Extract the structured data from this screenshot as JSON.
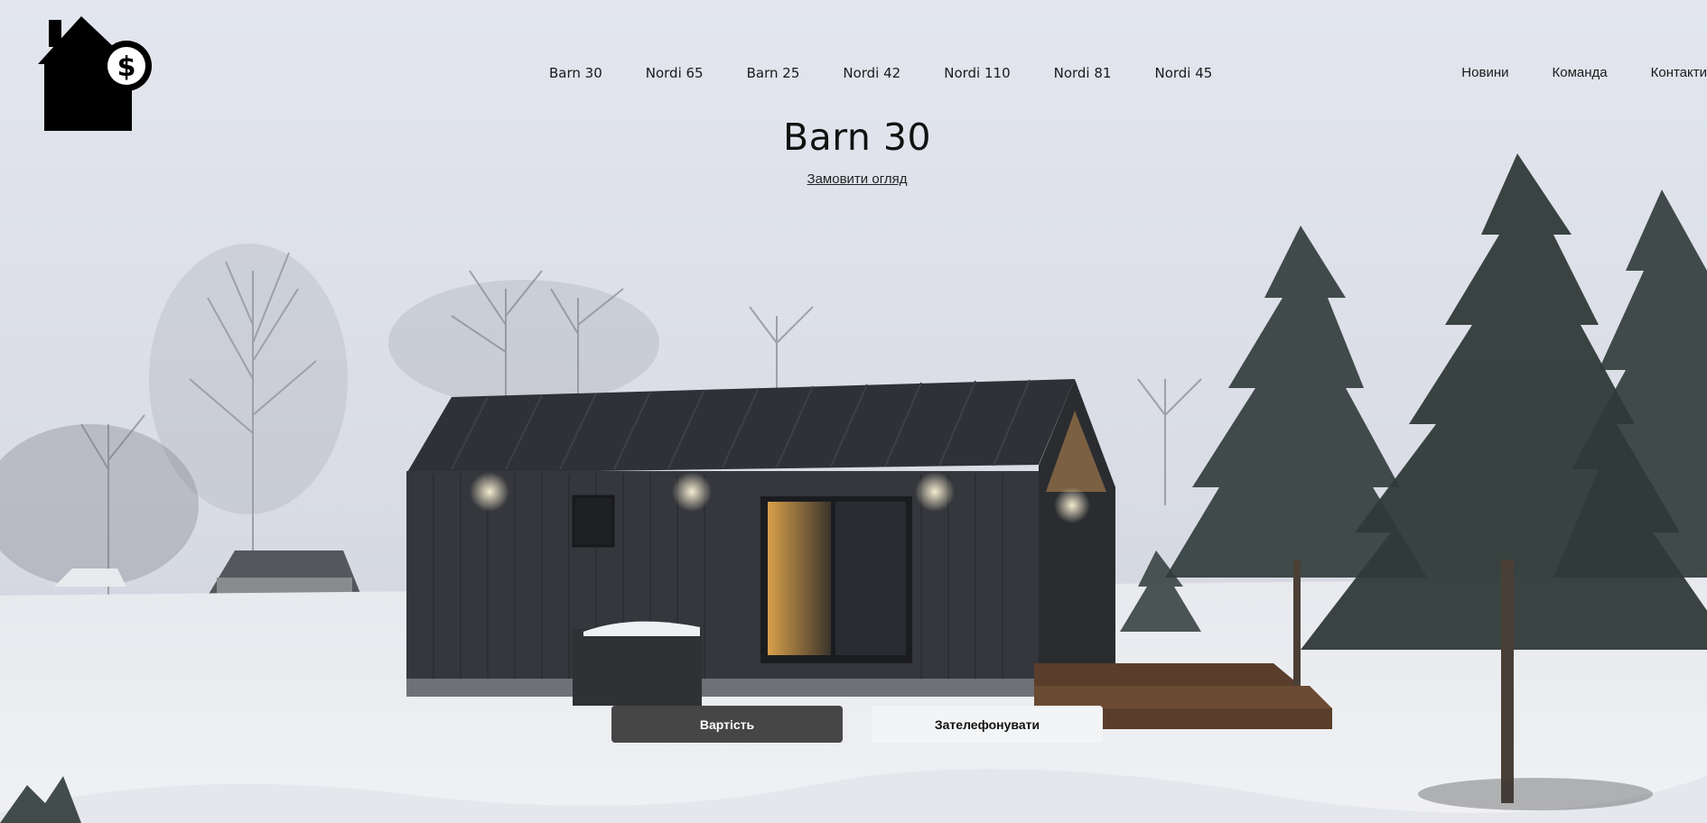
{
  "logo": {
    "icon": "house-dollar-icon"
  },
  "nav": {
    "models": [
      "Barn 30",
      "Nordi 65",
      "Barn 25",
      "Nordi 42",
      "Nordi 110",
      "Nordi 81",
      "Nordi 45"
    ],
    "links": [
      "Новини",
      "Команда",
      "Контакти"
    ]
  },
  "hero": {
    "title": "Barn 30",
    "order_link": "Замовити огляд",
    "price_button": "Вартість",
    "call_button": "Зателефонувати"
  },
  "colors": {
    "primary_button": "#464646",
    "secondary_button": "#f3f4f6",
    "sky": "#dfe2ea",
    "snow": "#eef0f4",
    "cabin": "#34363b"
  }
}
